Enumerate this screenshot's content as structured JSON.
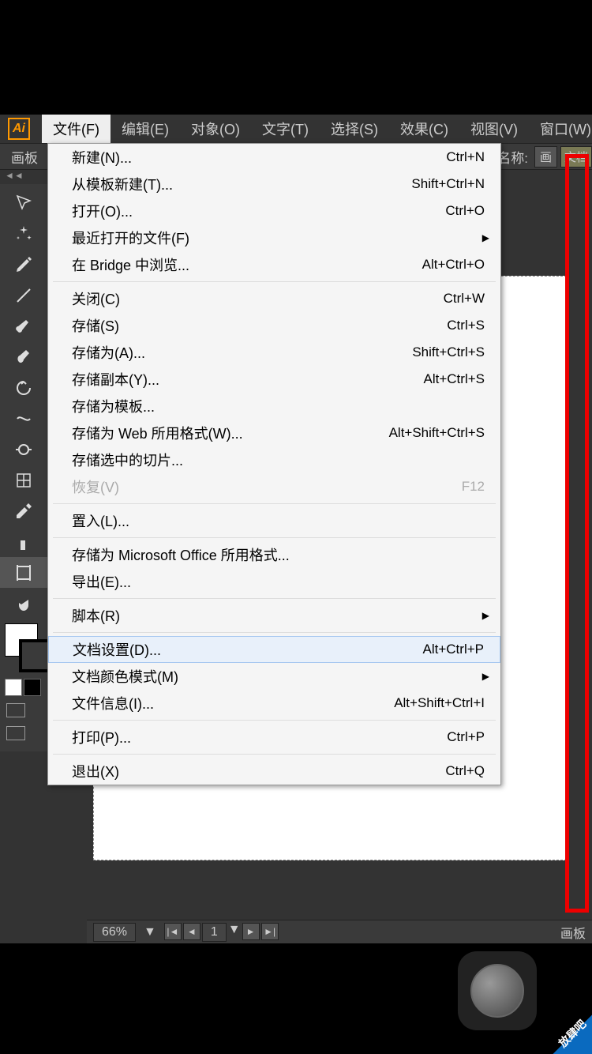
{
  "menubar": {
    "items": [
      "文件(F)",
      "编辑(E)",
      "对象(O)",
      "文字(T)",
      "选择(S)",
      "效果(C)",
      "视图(V)",
      "窗口(W)"
    ]
  },
  "optbar": {
    "tab": "画板",
    "name_label": "名称:",
    "name_btn": "画",
    "name_val": "文档"
  },
  "dropdown": {
    "groups": [
      [
        {
          "label": "新建(N)...",
          "short": "Ctrl+N"
        },
        {
          "label": "从模板新建(T)...",
          "short": "Shift+Ctrl+N"
        },
        {
          "label": "打开(O)...",
          "short": "Ctrl+O"
        },
        {
          "label": "最近打开的文件(F)",
          "short": "",
          "sub": true
        },
        {
          "label": "在 Bridge 中浏览...",
          "short": "Alt+Ctrl+O"
        }
      ],
      [
        {
          "label": "关闭(C)",
          "short": "Ctrl+W"
        },
        {
          "label": "存储(S)",
          "short": "Ctrl+S"
        },
        {
          "label": "存储为(A)...",
          "short": "Shift+Ctrl+S"
        },
        {
          "label": "存储副本(Y)...",
          "short": "Alt+Ctrl+S"
        },
        {
          "label": "存储为模板...",
          "short": ""
        },
        {
          "label": "存储为 Web 所用格式(W)...",
          "short": "Alt+Shift+Ctrl+S"
        },
        {
          "label": "存储选中的切片...",
          "short": ""
        },
        {
          "label": "恢复(V)",
          "short": "F12",
          "disabled": true
        }
      ],
      [
        {
          "label": "置入(L)...",
          "short": ""
        }
      ],
      [
        {
          "label": "存储为 Microsoft Office 所用格式...",
          "short": ""
        },
        {
          "label": "导出(E)...",
          "short": ""
        }
      ],
      [
        {
          "label": "脚本(R)",
          "short": "",
          "sub": true
        }
      ],
      [
        {
          "label": "文档设置(D)...",
          "short": "Alt+Ctrl+P",
          "hl": true
        },
        {
          "label": "文档颜色模式(M)",
          "short": "",
          "sub": true
        },
        {
          "label": "文件信息(I)...",
          "short": "Alt+Shift+Ctrl+I"
        }
      ],
      [
        {
          "label": "打印(P)...",
          "short": "Ctrl+P"
        }
      ],
      [
        {
          "label": "退出(X)",
          "short": "Ctrl+Q"
        }
      ]
    ]
  },
  "status": {
    "zoom": "66%",
    "page": "1",
    "label": "画板"
  },
  "corner": "放肆吧",
  "logo": "Ai"
}
